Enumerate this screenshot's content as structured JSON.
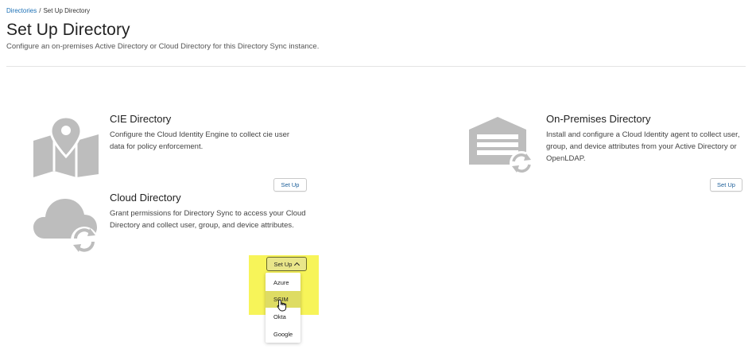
{
  "breadcrumb": {
    "link": "Directories",
    "separator": "/",
    "current": "Set Up Directory"
  },
  "page": {
    "title": "Set Up Directory",
    "subtitle": "Configure an on-premises Active Directory or Cloud Directory for this Directory Sync instance."
  },
  "cards": {
    "cie": {
      "title": "CIE Directory",
      "desc_line1": "Configure the Cloud Identity Engine to collect cie user",
      "desc_line2": "data for policy enforcement.",
      "button": "Set Up",
      "icon": "map-pin-icon"
    },
    "onprem": {
      "title": "On-Premises Directory",
      "desc_line1": "Install and configure a Cloud Identity agent to collect user,",
      "desc_line2": "group, and device attributes from your Active Directory or",
      "desc_line3": "OpenLDAP.",
      "button": "Set Up",
      "icon": "server-sync-icon"
    },
    "cloud": {
      "title": "Cloud Directory",
      "desc_line1": "Grant permissions for Directory Sync to access your Cloud",
      "desc_line2": "Directory and collect user, group, and device attributes.",
      "button": "Set Up",
      "icon": "cloud-sync-icon",
      "dropdown": [
        "Azure",
        "SCIM",
        "Okta",
        "Google"
      ],
      "hovered": "SCIM"
    }
  },
  "colors": {
    "link": "#1a6fb5",
    "icon_gray": "#bdbdbd",
    "highlight": "#f6f34b"
  }
}
